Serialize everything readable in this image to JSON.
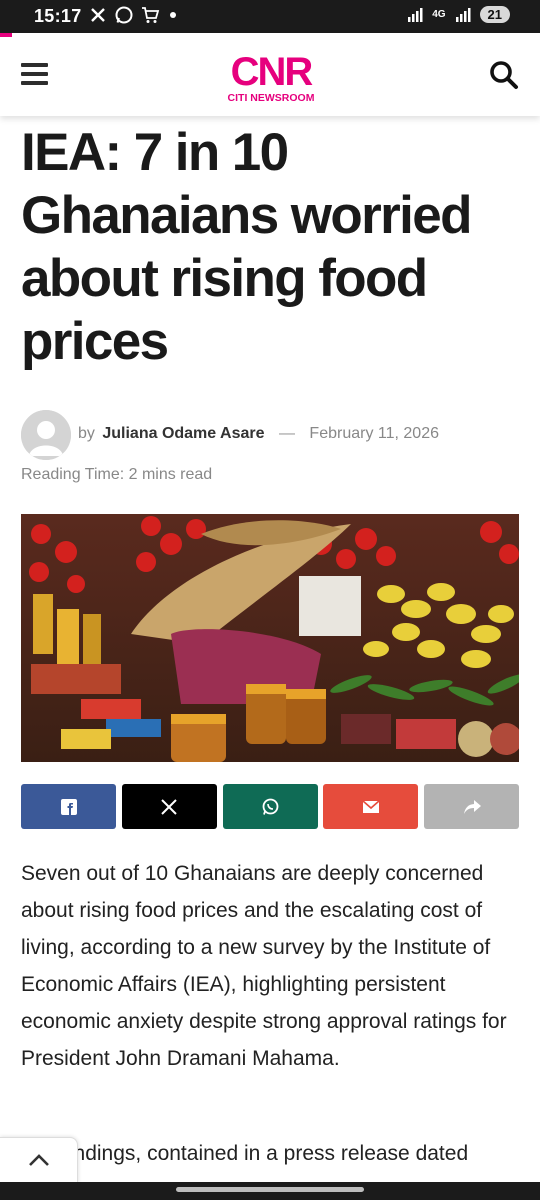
{
  "status_bar": {
    "time": "15:17",
    "battery": "21",
    "network": "4G"
  },
  "header": {
    "logo_text": "CNR",
    "logo_subtext": "CITI NEWSROOM",
    "brand_color": "#e6007e"
  },
  "article": {
    "headline_lines": [
      "IEA: 7 in 10",
      "Ghanaians worried",
      "about rising food",
      "prices"
    ],
    "byline_prefix": "by",
    "author": "Juliana Odame Asare",
    "date_separator": "—",
    "date": "February 11, 2026",
    "reading_time": "Reading Time: 2 mins read",
    "body_paragraph_1": "Seven out of 10 Ghanaians are deeply concerned about rising food prices and the escalating cost of living, according to a new survey by the Institute of Economic Affairs (IEA), highlighting persistent economic anxiety despite strong approval ratings for President John Dramani Mahama.",
    "body_paragraph_2_start": "The findings, contained in a press release dated"
  },
  "share_buttons": [
    {
      "name": "facebook",
      "icon": "facebook-icon",
      "color": "#3b5998"
    },
    {
      "name": "x",
      "icon": "x-icon",
      "color": "#000000"
    },
    {
      "name": "whatsapp",
      "icon": "whatsapp-icon",
      "color": "#0f6b55"
    },
    {
      "name": "email",
      "icon": "email-icon",
      "color": "#e64c3c"
    },
    {
      "name": "share",
      "icon": "share-arrow-icon",
      "color": "#b3b3b3"
    }
  ]
}
